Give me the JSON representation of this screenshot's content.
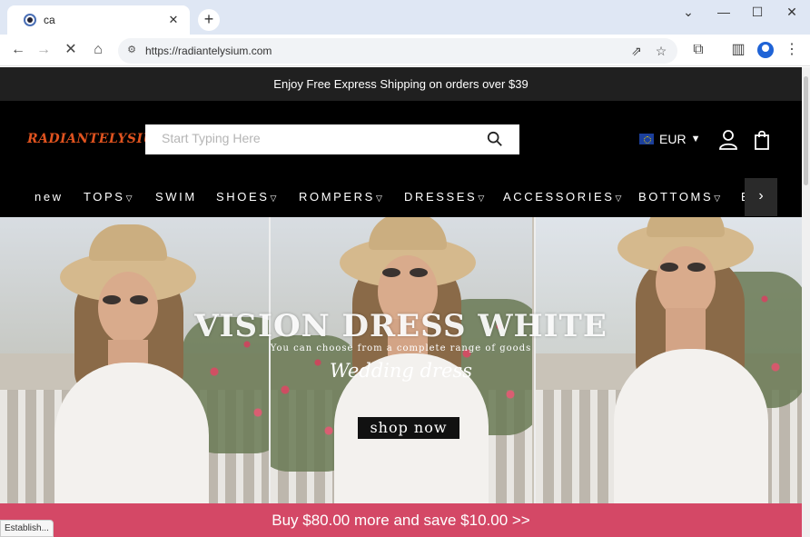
{
  "browser": {
    "tab_title": "ca",
    "tab_close": "✕",
    "new_tab": "+",
    "url": "https://radiantelysium.com",
    "status_text": "Establish..."
  },
  "site": {
    "announcement": "Enjoy Free Express Shipping on orders over $39",
    "logo": "RADIANTELYSIUM",
    "search_placeholder": "Start Typing Here",
    "currency": "EUR",
    "nav": [
      {
        "label": "new",
        "has_dropdown": false
      },
      {
        "label": "TOPS",
        "has_dropdown": true
      },
      {
        "label": "SWIM",
        "has_dropdown": false
      },
      {
        "label": "SHOES",
        "has_dropdown": true
      },
      {
        "label": "ROMPERS",
        "has_dropdown": true
      },
      {
        "label": "DRESSES",
        "has_dropdown": true
      },
      {
        "label": "ACCESSORIES",
        "has_dropdown": true
      },
      {
        "label": "BOTTOMS",
        "has_dropdown": true
      },
      {
        "label": "B",
        "has_dropdown": false
      }
    ],
    "hero": {
      "title": "VISION DRESS WHITE",
      "subtitle": "You can choose from a complete range of goods",
      "script": "Wedding dress",
      "button": "shop now"
    },
    "promo": "Buy $80.00 more and save $10.00  >>"
  },
  "colors": {
    "announcement_bg": "#202020",
    "header_bg": "#000000",
    "promo_bg": "#d44866",
    "logo": "#e0531f",
    "browser_frame": "#dfe7f4"
  }
}
